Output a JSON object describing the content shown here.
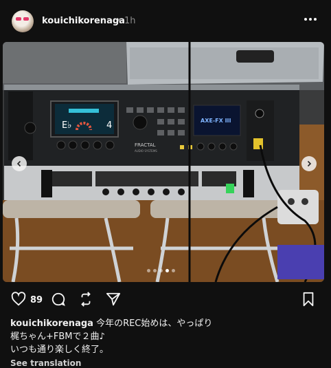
{
  "post": {
    "username": "kouichikorenaga",
    "separator": "•",
    "time": "1h",
    "like_count": "89",
    "caption_line1": "今年のREC始めは、やっぱり",
    "caption_line2": "梶ちゃん+FBMで２曲♪",
    "caption_line3": "いつも通り楽しく終了。",
    "see_translation": "See translation"
  },
  "photo_labels": {
    "tuner_note": "E♭",
    "tuner_string": "4",
    "brand": "FRACTAL",
    "brand_sub": "AUDIO SYSTEMS",
    "model": "AXE-FX III"
  },
  "carousel": {
    "total": 5,
    "active_index": 3
  },
  "icons": [
    "more-icon",
    "heart-icon",
    "comment-icon",
    "repost-icon",
    "share-icon",
    "bookmark-icon",
    "chevron-left-icon",
    "chevron-right-icon"
  ]
}
